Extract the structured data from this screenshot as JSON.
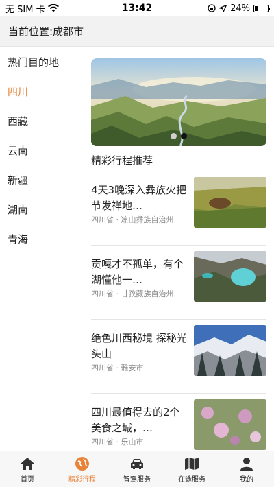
{
  "statusbar": {
    "carrier": "无 SIM 卡",
    "time": "13:42",
    "battery": "24%",
    "battery_level": 0.24
  },
  "location": {
    "label": "当前位置:成都市"
  },
  "sidebar": {
    "header": "热门目的地",
    "items": [
      {
        "label": "四川",
        "active": true
      },
      {
        "label": "西藏"
      },
      {
        "label": "云南"
      },
      {
        "label": "新疆"
      },
      {
        "label": "湖南"
      },
      {
        "label": "青海"
      }
    ]
  },
  "banner": {
    "page_count": 2,
    "current_page": 2
  },
  "section": {
    "title": "精彩行程推荐"
  },
  "trips": [
    {
      "title": "4天3晚深入彝族火把节发祥地…",
      "location": "四川省 · 凉山彝族自治州"
    },
    {
      "title": "贡嘎才不孤单，有个湖懂他一…",
      "location": "四川省 · 甘孜藏族自治州"
    },
    {
      "title": "绝色川西秘境 探秘光头山",
      "location": "四川省 · 雅安市"
    },
    {
      "title": "四川最值得去的2个美食之城，…",
      "location": "四川省 · 乐山市"
    }
  ],
  "tabbar": {
    "tabs": [
      {
        "label": "首页",
        "icon": "home-icon"
      },
      {
        "label": "精彩行程",
        "icon": "globe-icon",
        "active": true
      },
      {
        "label": "智驾服务",
        "icon": "car-icon"
      },
      {
        "label": "在途服务",
        "icon": "map-icon"
      },
      {
        "label": "我的",
        "icon": "user-icon"
      }
    ]
  },
  "colors": {
    "accent": "#e8833a",
    "text": "#222222",
    "muted": "#888888"
  }
}
